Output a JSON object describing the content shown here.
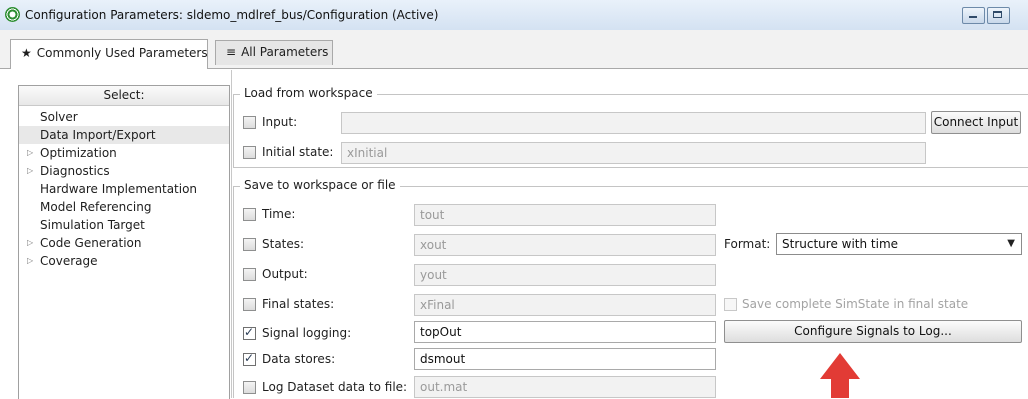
{
  "window": {
    "title": "Configuration Parameters: sldemo_mdlref_bus/Configuration (Active)",
    "app_icon": "simulink-gear-icon"
  },
  "tabs": [
    {
      "icon": "★",
      "label": "Commonly Used Parameters",
      "active": true
    },
    {
      "icon": "≡",
      "label": "All Parameters",
      "active": false
    }
  ],
  "select_panel": {
    "header": "Select:",
    "items": [
      {
        "label": "Solver",
        "expandable": false,
        "selected": false
      },
      {
        "label": "Data Import/Export",
        "expandable": false,
        "selected": true
      },
      {
        "label": "Optimization",
        "expandable": true,
        "selected": false
      },
      {
        "label": "Diagnostics",
        "expandable": true,
        "selected": false
      },
      {
        "label": "Hardware Implementation",
        "expandable": false,
        "selected": false
      },
      {
        "label": "Model Referencing",
        "expandable": false,
        "selected": false
      },
      {
        "label": "Simulation Target",
        "expandable": false,
        "selected": false
      },
      {
        "label": "Code Generation",
        "expandable": true,
        "selected": false
      },
      {
        "label": "Coverage",
        "expandable": true,
        "selected": false
      }
    ]
  },
  "load_group": {
    "title": "Load from workspace",
    "input": {
      "label": "Input:",
      "checked": false,
      "value": ""
    },
    "connect_button": "Connect Input",
    "initial_state": {
      "label": "Initial state:",
      "checked": false,
      "value": "xInitial"
    }
  },
  "save_group": {
    "title": "Save to workspace or file",
    "rows": [
      {
        "label": "Time:",
        "checked": false,
        "value": "tout"
      },
      {
        "label": "States:",
        "checked": false,
        "value": "xout"
      },
      {
        "label": "Output:",
        "checked": false,
        "value": "yout"
      },
      {
        "label": "Final states:",
        "checked": false,
        "value": "xFinal"
      },
      {
        "label": "Signal logging:",
        "checked": true,
        "value": "topOut"
      },
      {
        "label": "Data stores:",
        "checked": true,
        "value": "dsmout"
      },
      {
        "label": "Log Dataset data to file:",
        "checked": false,
        "value": "out.mat"
      }
    ],
    "format_label": "Format:",
    "format_value": "Structure with time",
    "save_simstate_label": "Save complete SimState in final state",
    "configure_button": "Configure Signals to Log..."
  },
  "colors": {
    "annotation_arrow": "#e23b35",
    "titlebar": "#dbe7f5"
  }
}
